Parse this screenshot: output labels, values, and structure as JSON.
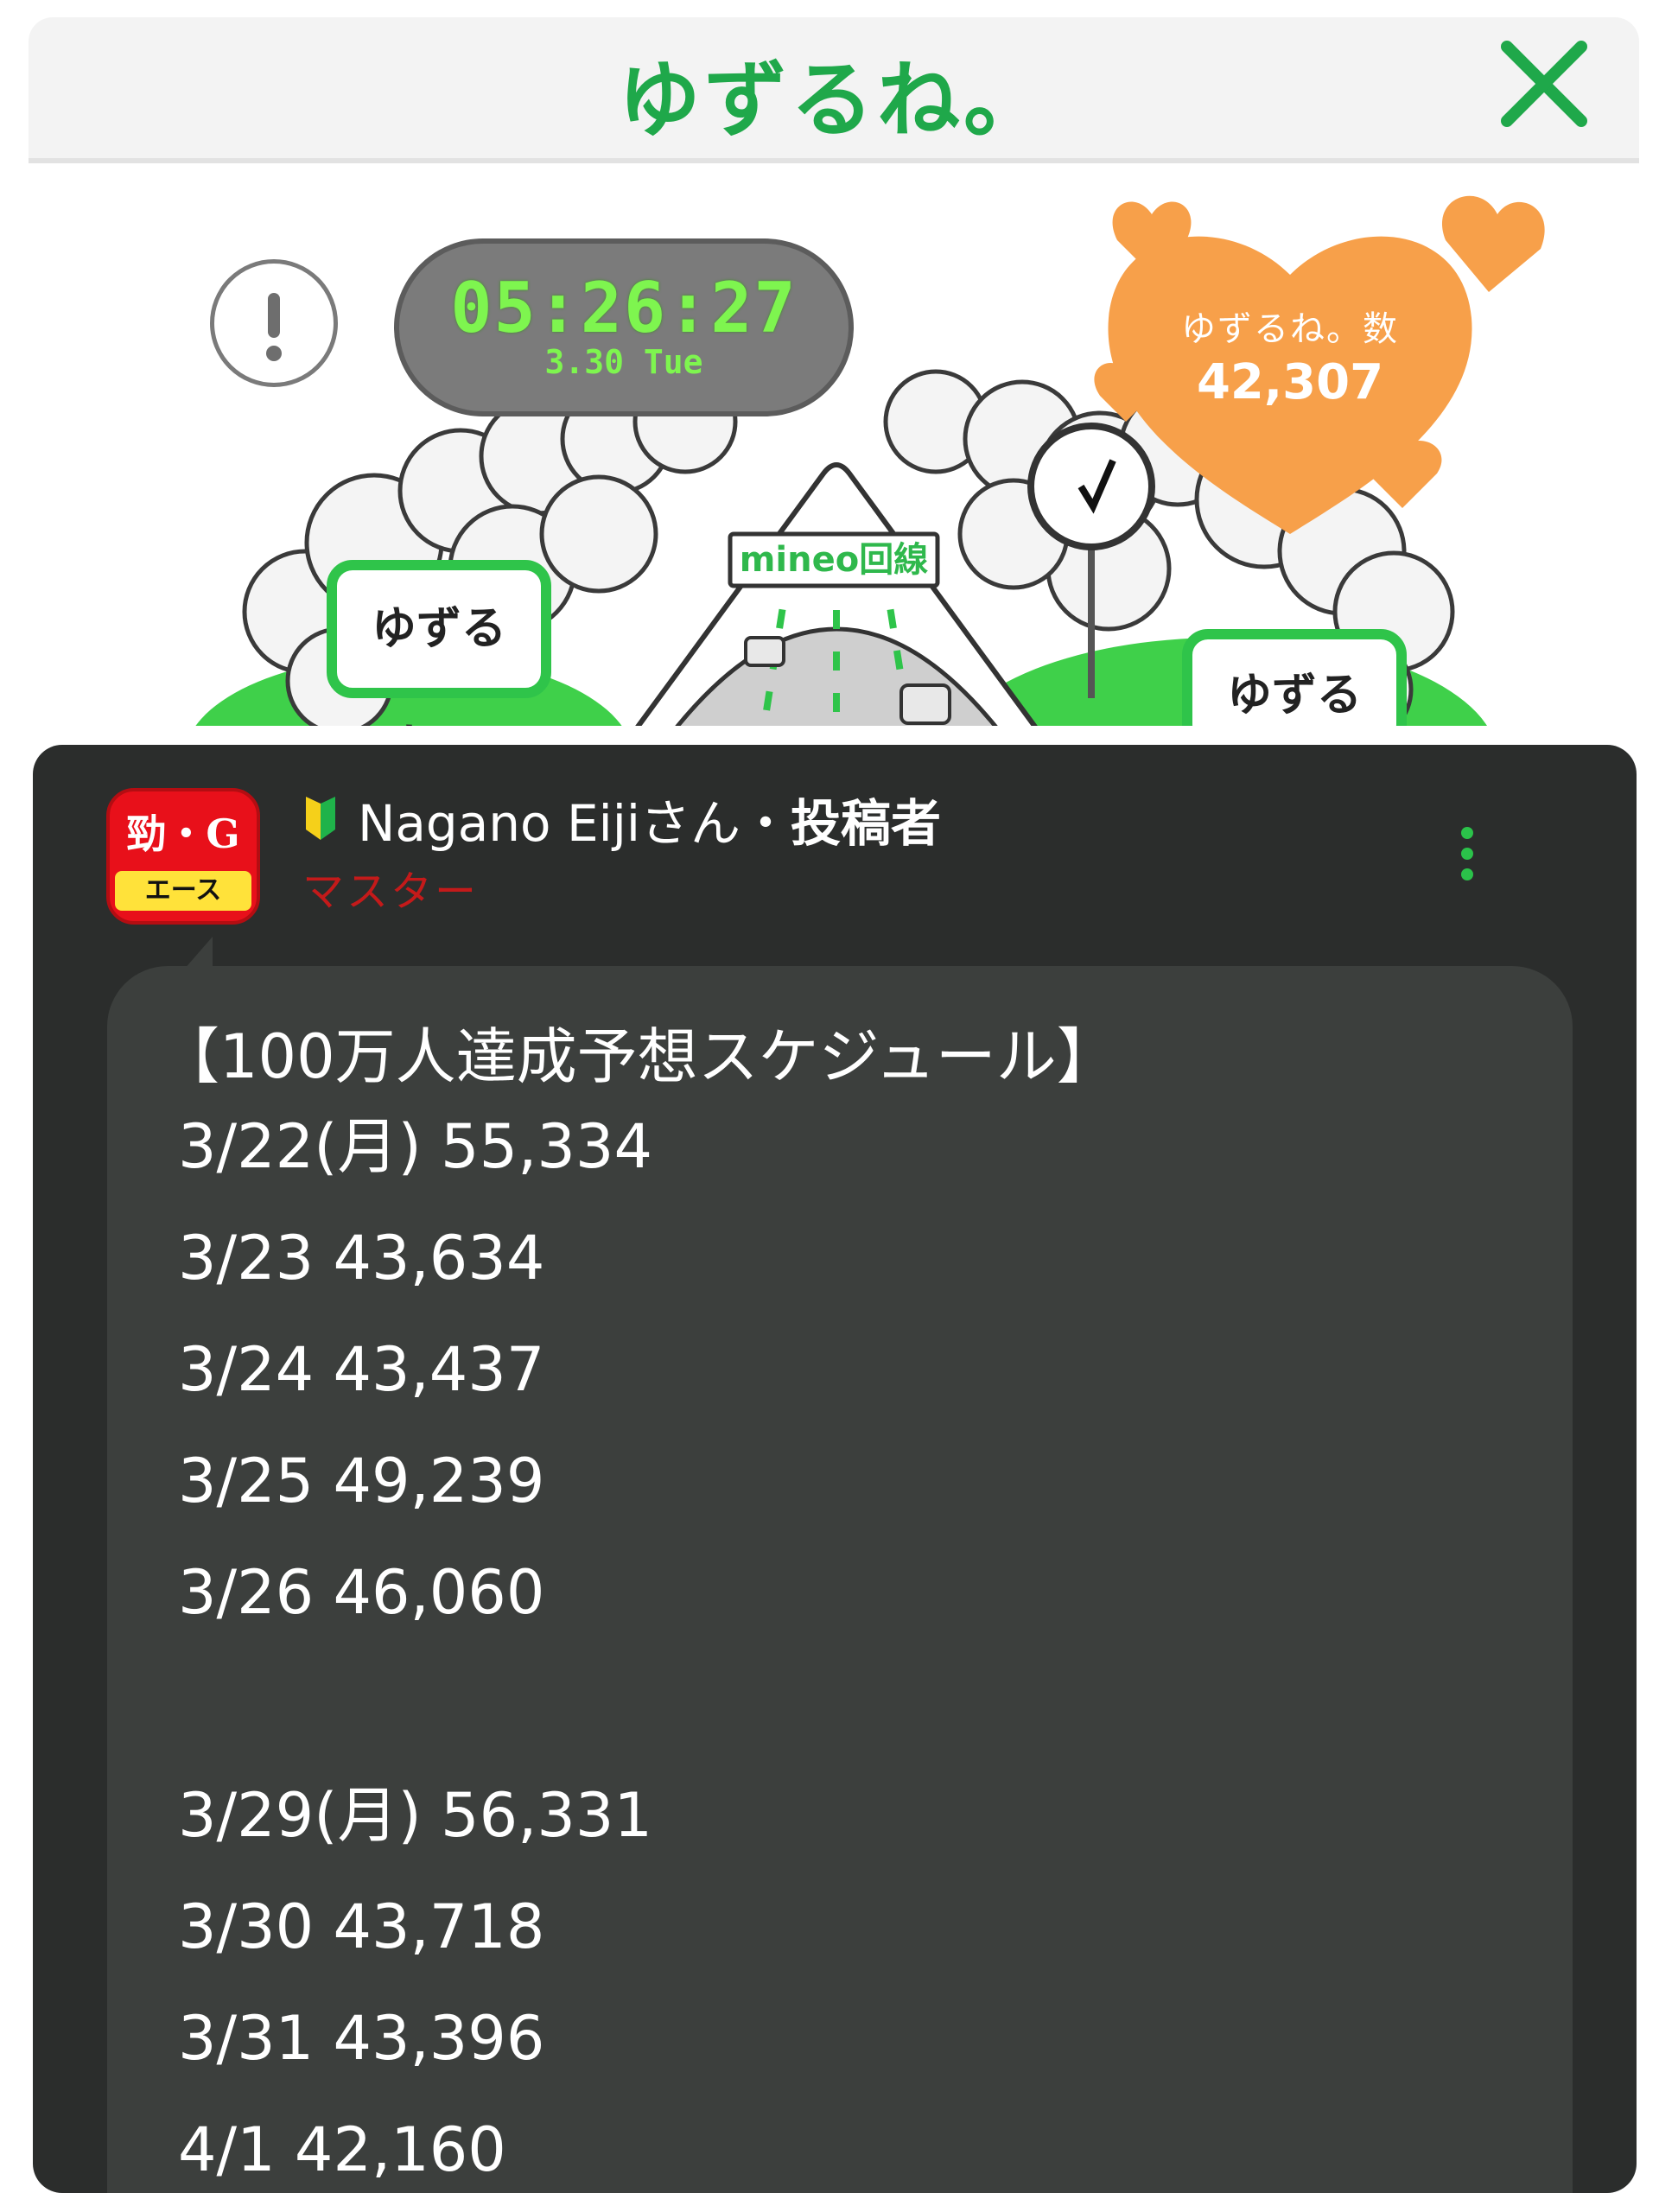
{
  "header": {
    "title": "ゆずるね。",
    "close_icon": "close-icon"
  },
  "scene": {
    "clock_time": "05:26:27",
    "clock_date": "3.30 Tue",
    "count_label": "ゆずるね。数",
    "count_value": "42,307",
    "sign_text": "mineo回線",
    "bubble_left": "ゆずるね。",
    "bubble_right": "ゆずるね。",
    "info_icon": "exclamation-icon",
    "colors": {
      "accent": "#1fa84a",
      "heart": "#f7a04a",
      "clock_text": "#7ef54f"
    }
  },
  "post": {
    "avatar_mark": "勁・G",
    "avatar_band": "エース",
    "author_name": "Nagano Eijiさん・",
    "author_role": "投稿者",
    "author_rank": "マスター",
    "title": "【100万人達成予想スケジュール】",
    "lines": [
      "3/22(月) 55,334",
      "3/23 43,634",
      "3/24 43,437",
      "3/25 49,239",
      "3/26 46,060",
      "",
      "3/29(月) 56,331",
      "3/30 43,718",
      "3/31 43,396",
      "4/1 42,160"
    ]
  }
}
